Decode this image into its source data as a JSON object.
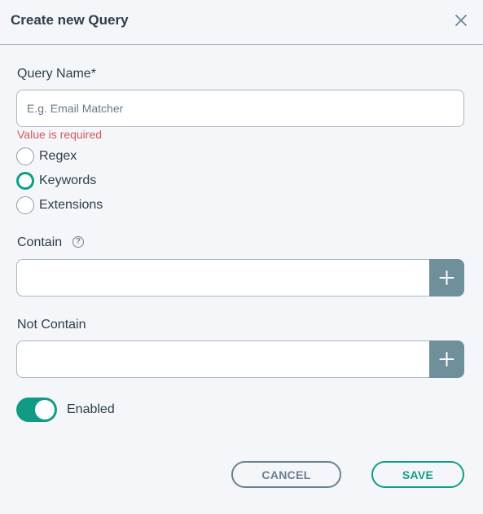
{
  "dialog": {
    "title": "Create new Query",
    "close_icon": "close-icon"
  },
  "query_name": {
    "label": "Query Name*",
    "placeholder": "E.g. Email Matcher",
    "value": "",
    "error": "Value is required"
  },
  "query_type": {
    "options": [
      {
        "label": "Regex",
        "selected": false
      },
      {
        "label": "Keywords",
        "selected": true
      },
      {
        "label": "Extensions",
        "selected": false
      }
    ]
  },
  "contain": {
    "label": "Contain",
    "help_icon": "help-circle-icon",
    "value": "",
    "add_icon": "plus-icon"
  },
  "not_contain": {
    "label": "Not Contain",
    "value": "",
    "add_icon": "plus-icon"
  },
  "enabled": {
    "label": "Enabled",
    "on": true
  },
  "actions": {
    "cancel_label": "CANCEL",
    "save_label": "SAVE"
  },
  "colors": {
    "accent": "#0f9e86",
    "error": "#d4595a",
    "secondary": "#6a808d",
    "add_button": "#6f8f9b"
  }
}
